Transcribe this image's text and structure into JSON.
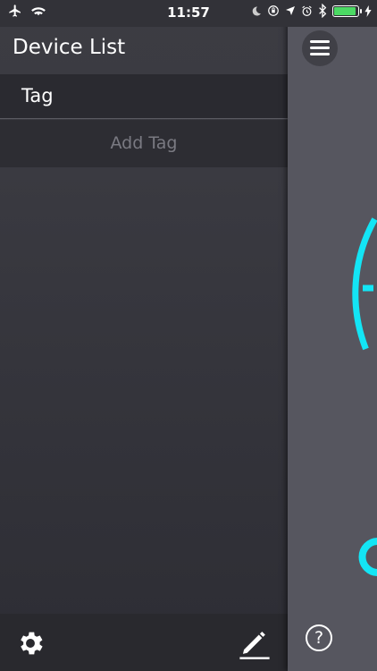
{
  "status_bar": {
    "time": "11:57",
    "icons": [
      "airplane-icon",
      "wifi-icon",
      "moon-icon",
      "orientation-lock-icon",
      "location-icon",
      "alarm-icon",
      "bluetooth-icon",
      "battery-icon",
      "charging-icon"
    ],
    "battery_level": 0.85,
    "battery_color": "#4cd964"
  },
  "drawer": {
    "title": "Device List",
    "items": [
      {
        "label": "Tag"
      }
    ],
    "add_label": "Add Tag",
    "footer_icons": [
      "gear-icon",
      "pencil-icon"
    ]
  },
  "main": {
    "icons": [
      "hamburger-menu-icon",
      "help-icon",
      "ring-gauge-icon"
    ],
    "help_glyph": "?",
    "accent": "#13e5f5"
  }
}
